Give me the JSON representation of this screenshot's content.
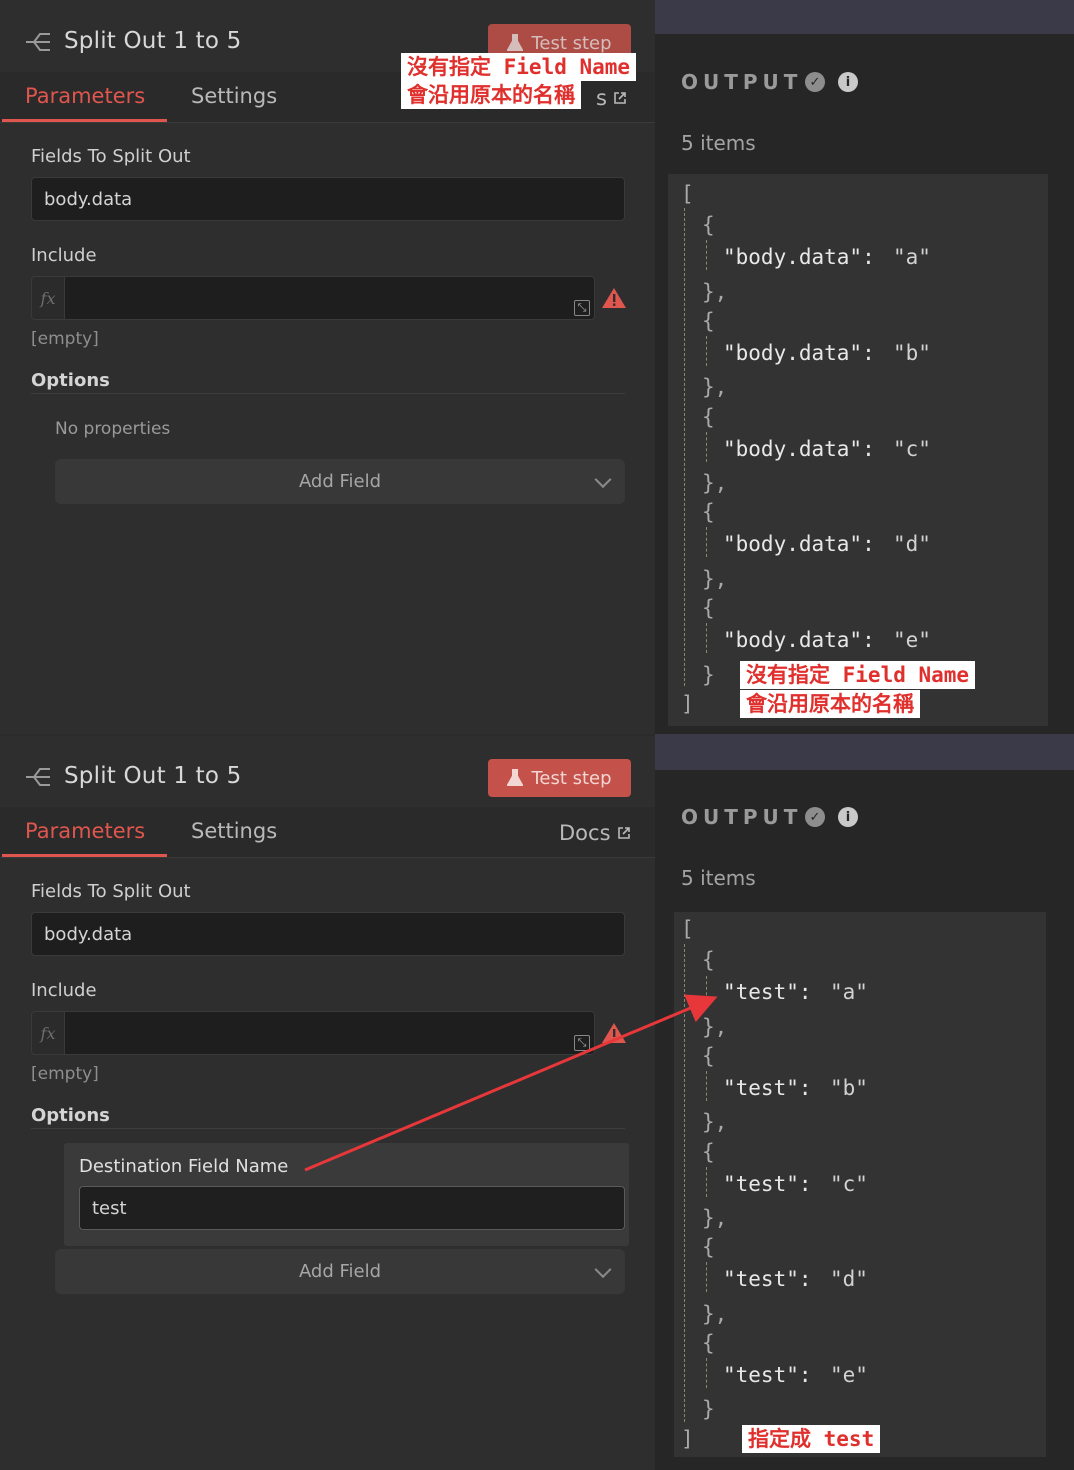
{
  "top": {
    "node_title": "Split Out 1 to 5",
    "test_step_label": "Test step",
    "tabs": {
      "parameters": "Parameters",
      "settings": "Settings"
    },
    "docs_label": "s",
    "fields_label": "Fields To Split Out",
    "fields_value": "body.data",
    "include_label": "Include",
    "include_value_hint": "[empty]",
    "options_label": "Options",
    "no_properties": "No properties",
    "add_field": "Add Field",
    "output_title": "OUTPUT",
    "items_count": "5 items",
    "json": {
      "open": "[",
      "close": "]",
      "key": "\"body.data\":",
      "values": [
        "\"a\"",
        "\"b\"",
        "\"c\"",
        "\"d\"",
        "\"e\""
      ]
    },
    "annotation_header_line1": "沒有指定 Field Name",
    "annotation_header_line2": "會沿用原本的名稱",
    "annotation_output_line1": "沒有指定 Field Name",
    "annotation_output_line2": "會沿用原本的名稱"
  },
  "bottom": {
    "node_title": "Split Out 1 to 5",
    "test_step_label": "Test step",
    "tabs": {
      "parameters": "Parameters",
      "settings": "Settings"
    },
    "docs_label": "Docs",
    "fields_label": "Fields To Split Out",
    "fields_value": "body.data",
    "include_label": "Include",
    "include_value_hint": "[empty]",
    "options_label": "Options",
    "destination_label": "Destination Field Name",
    "destination_value": "test",
    "add_field": "Add Field",
    "output_title": "OUTPUT",
    "items_count": "5 items",
    "json": {
      "open": "[",
      "close": "]",
      "key": "\"test\":",
      "values": [
        "\"a\"",
        "\"b\"",
        "\"c\"",
        "\"d\"",
        "\"e\""
      ]
    },
    "annotation": "指定成 test"
  },
  "colors": {
    "accent": "#e0564f",
    "test_button": "#c4514a",
    "annotation_text": "#e0302d",
    "arrow": "#e8373a"
  },
  "icons": [
    "split-out-node-icon",
    "flask-icon",
    "external-link-icon",
    "resize-icon",
    "warning-icon",
    "check-circle-icon",
    "info-icon",
    "chevron-down-icon"
  ]
}
